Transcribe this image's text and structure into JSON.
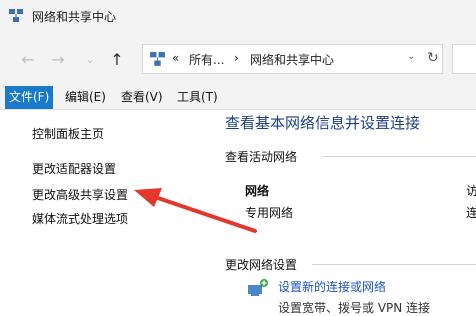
{
  "window": {
    "title": "网络和共享中心"
  },
  "address": {
    "overflow_glyph": "«",
    "segments": [
      "所有...",
      "网络和共享中心"
    ],
    "separator": "›"
  },
  "menubar": {
    "items": [
      {
        "label": "文件(F)",
        "active": true
      },
      {
        "label": "编辑(E)",
        "active": false
      },
      {
        "label": "查看(V)",
        "active": false
      },
      {
        "label": "工具(T)",
        "active": false
      }
    ]
  },
  "sidebar": {
    "items": [
      {
        "label": "控制面板主页"
      },
      {
        "label": "更改适配器设置"
      },
      {
        "label": "更改高级共享设置"
      },
      {
        "label": "媒体流式处理选项"
      }
    ]
  },
  "main": {
    "heading": "查看基本网络信息并设置连接",
    "active_networks_label": "查看活动网络",
    "network": {
      "name": "网络",
      "type": "专用网络"
    },
    "right_truncated": [
      "访",
      "连"
    ],
    "change_settings_label": "更改网络设置",
    "setup": {
      "link": "设置新的连接或网络",
      "desc": "设置宽带、拨号或 VPN 连接"
    }
  },
  "icons": {
    "back": "back-arrow-icon",
    "forward": "forward-arrow-icon",
    "recent": "chevron-down-icon",
    "up": "up-arrow-icon",
    "refresh": "refresh-icon"
  },
  "colors": {
    "accent": "#1979ca",
    "heading": "#1e3f8a",
    "link": "#1e54c9",
    "annotation_arrow": "#e5362b"
  }
}
